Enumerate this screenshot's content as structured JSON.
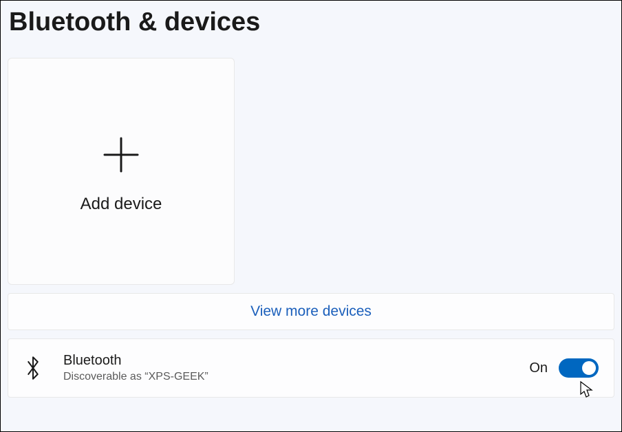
{
  "page": {
    "title": "Bluetooth & devices"
  },
  "add_device": {
    "label": "Add device"
  },
  "view_more": {
    "label": "View more devices"
  },
  "bluetooth": {
    "title": "Bluetooth",
    "subtitle": "Discoverable as “XPS-GEEK”",
    "toggle_label": "On",
    "toggle_state": true
  },
  "colors": {
    "accent": "#0067c0",
    "link": "#1b5fbb"
  }
}
